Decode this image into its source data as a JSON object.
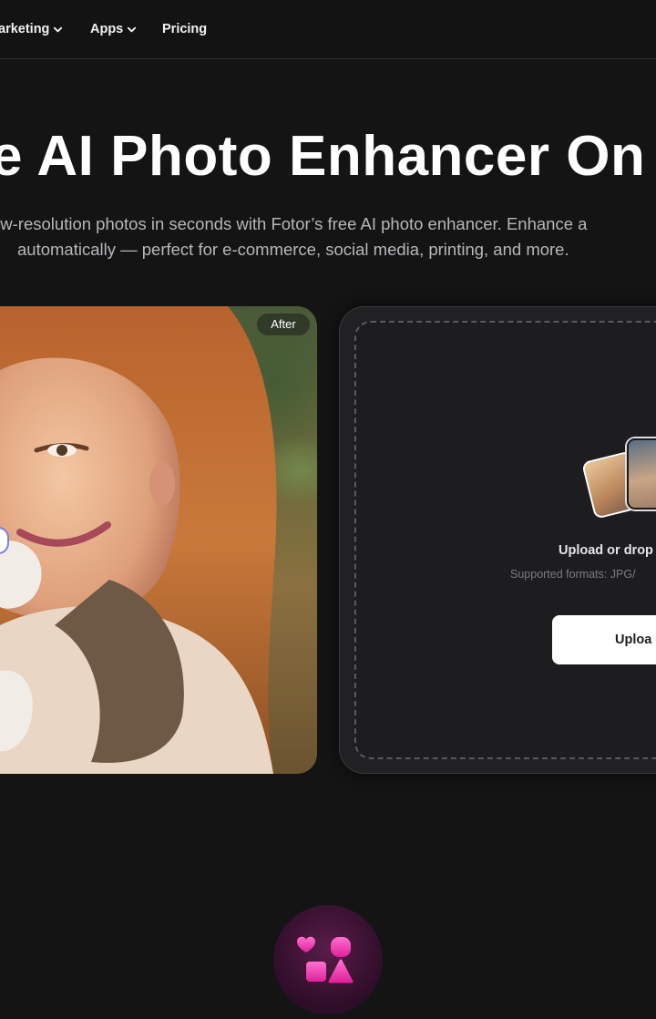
{
  "nav": {
    "items": [
      {
        "label": "arketing",
        "has_chevron": true
      },
      {
        "label": "Apps",
        "has_chevron": true
      },
      {
        "label": "Pricing",
        "has_chevron": false
      }
    ]
  },
  "hero": {
    "title": "e AI Photo Enhancer On",
    "subtitle_line1": "ow-resolution photos in seconds with Fotor’s free AI photo enhancer. Enhance a",
    "subtitle_line2": "automatically — perfect for e-commerce, social media, printing, and more."
  },
  "compare": {
    "after_label": "After"
  },
  "upload": {
    "title": "Upload or drop",
    "formats": "Supported formats: JPG/",
    "button_label": "Uploa"
  },
  "icons": {
    "nav_chevron": "chevron-down-icon",
    "apps_icon": "apps-shapes-icon"
  },
  "colors": {
    "background": "#141415",
    "accent_pink": "#ff3fb4",
    "text_primary": "#ffffff",
    "text_secondary": "#b7b7bb"
  }
}
